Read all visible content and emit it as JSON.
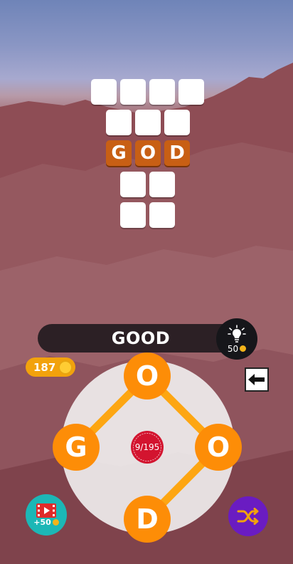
{
  "current_word": "GOOD",
  "hint": {
    "cost": "50",
    "icon": "lightbulb-icon"
  },
  "coins": {
    "amount": "187",
    "icon": "coin-icon"
  },
  "back": {
    "icon": "arrow-left-icon"
  },
  "wheel": {
    "letters": [
      "O",
      "G",
      "O",
      "D"
    ],
    "progress": "9/195"
  },
  "video": {
    "reward": "+50",
    "icon": "video-reward-icon"
  },
  "shuffle": {
    "icon": "shuffle-icon"
  },
  "crossword": {
    "solved_word": [
      "G",
      "O",
      "D"
    ]
  },
  "colors": {
    "letter_orange": "#fd8d07",
    "tile_solved": "#c85f14",
    "video_teal": "#1cb7b6",
    "shuffle_purple": "#6a1cc2",
    "progress_red": "#d3142f"
  }
}
